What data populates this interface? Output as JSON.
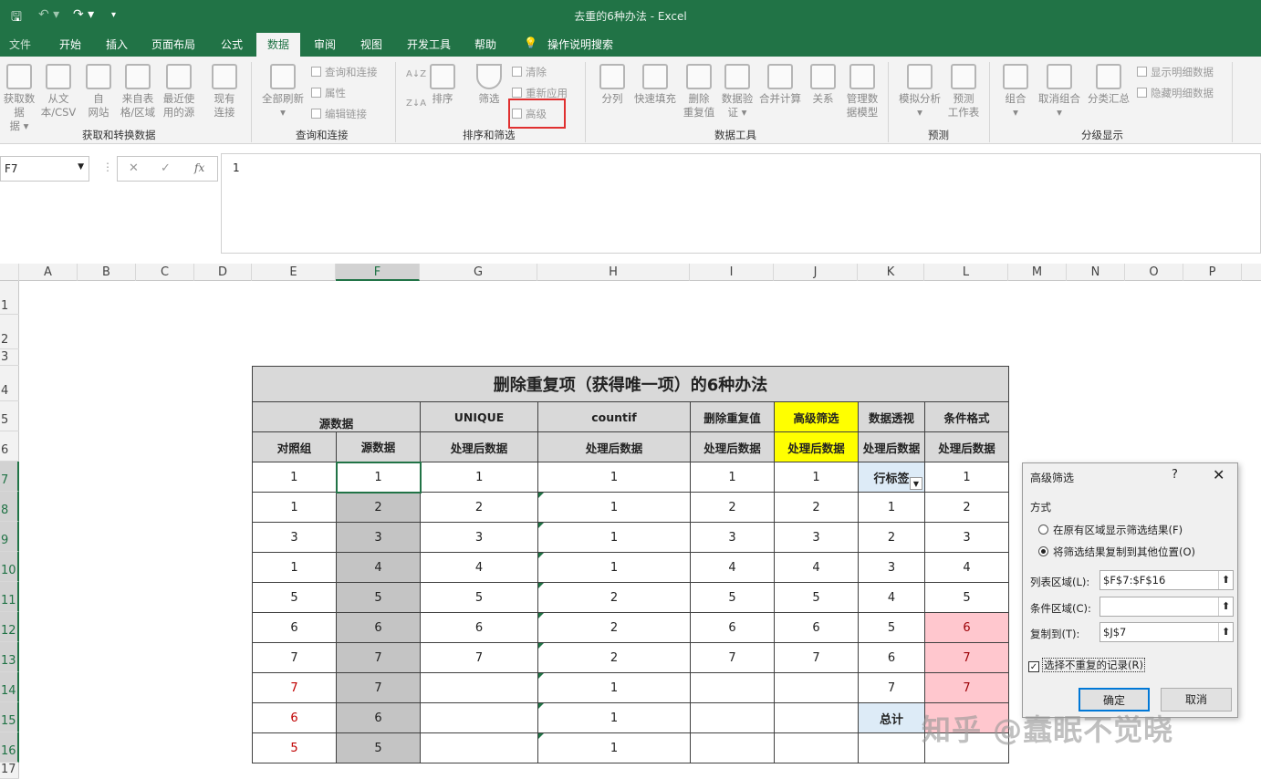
{
  "window": {
    "title": "去重的6种办法  -  Excel"
  },
  "tabs": [
    "文件",
    "开始",
    "插入",
    "页面布局",
    "公式",
    "数据",
    "审阅",
    "视图",
    "开发工具",
    "帮助"
  ],
  "tell_me": "操作说明搜索",
  "ribbon": {
    "get_data": {
      "b1": "获取数据",
      "b1b": "据 ▾",
      "b2": "从文",
      "b2b": "本/CSV",
      "b3": "自",
      "b3b": "网站",
      "b4": "来自表",
      "b4b": "格/区域",
      "b5": "最近使",
      "b5b": "用的源",
      "b6": "现有",
      "b6b": "连接",
      "label": "获取和转换数据"
    },
    "queries": {
      "refresh": "全部刷新",
      "refresh_b": "▾",
      "q1": "查询和连接",
      "q2": "属性",
      "q3": "编辑链接",
      "label": "查询和连接"
    },
    "sort": {
      "az": "A↓Z",
      "za": "Z↓A",
      "sort": "排序",
      "filter": "筛选",
      "clear": "清除",
      "reapply": "重新应用",
      "advanced": "高级",
      "label": "排序和筛选"
    },
    "tools": {
      "split": "分列",
      "flash": "快速填充",
      "dup": "删除",
      "dup_b": "重复值",
      "valid": "数据验",
      "valid_b": "证 ▾",
      "consol": "合并计算",
      "rel": "关系",
      "model": "管理数",
      "model_b": "据模型",
      "label": "数据工具"
    },
    "forecast": {
      "whatif": "模拟分析",
      "whatif_b": "▾",
      "sheet": "预测",
      "sheet_b": "工作表",
      "label": "预测"
    },
    "outline": {
      "group": "组合",
      "group_b": "▾",
      "ungroup": "取消组合",
      "ungroup_b": "▾",
      "subtotal": "分类汇总",
      "show": "显示明细数据",
      "hide": "隐藏明细数据",
      "label": "分级显示"
    }
  },
  "formula_bar": {
    "namebox": "F7",
    "cancel": "✕",
    "enter": "✓",
    "fx": "fx",
    "value": "1"
  },
  "columns": [
    "A",
    "B",
    "C",
    "D",
    "E",
    "F",
    "G",
    "H",
    "I",
    "J",
    "K",
    "L",
    "M",
    "N",
    "O",
    "P"
  ],
  "rows": [
    "1",
    "2",
    "3",
    "4",
    "5",
    "6",
    "7",
    "8",
    "9",
    "10",
    "11",
    "12",
    "13",
    "14",
    "15",
    "16",
    "17"
  ],
  "table": {
    "title": "删除重复项（获得唯一项）的6种办法",
    "h1": {
      "src": "源数据",
      "unique": "UNIQUE",
      "countif": "countif",
      "dedup": "删除重复值",
      "adv": "高级筛选",
      "pivot": "数据透视",
      "cond": "条件格式"
    },
    "h2": {
      "ctrl": "对照组",
      "src": "源数据",
      "processed": "处理后数据"
    },
    "rows": [
      {
        "e": "1",
        "f": "1",
        "g": "1",
        "h": "1",
        "i": "1",
        "j": "1",
        "k": "行标签",
        "l": "1"
      },
      {
        "e": "1",
        "f": "2",
        "g": "2",
        "h": "1",
        "i": "2",
        "j": "2",
        "k": "1",
        "l": "2"
      },
      {
        "e": "3",
        "f": "3",
        "g": "3",
        "h": "1",
        "i": "3",
        "j": "3",
        "k": "2",
        "l": "3"
      },
      {
        "e": "1",
        "f": "4",
        "g": "4",
        "h": "1",
        "i": "4",
        "j": "4",
        "k": "3",
        "l": "4"
      },
      {
        "e": "5",
        "f": "5",
        "g": "5",
        "h": "2",
        "i": "5",
        "j": "5",
        "k": "4",
        "l": "5"
      },
      {
        "e": "6",
        "f": "6",
        "g": "6",
        "h": "2",
        "i": "6",
        "j": "6",
        "k": "5",
        "l": "6"
      },
      {
        "e": "7",
        "f": "7",
        "g": "7",
        "h": "2",
        "i": "7",
        "j": "7",
        "k": "6",
        "l": "7"
      },
      {
        "e": "7",
        "f": "7",
        "g": "",
        "h": "1",
        "i": "",
        "j": "",
        "k": "7",
        "l": "7"
      },
      {
        "e": "6",
        "f": "6",
        "g": "",
        "h": "1",
        "i": "",
        "j": "",
        "k": "总计",
        "l": ""
      },
      {
        "e": "5",
        "f": "5",
        "g": "",
        "h": "1",
        "i": "",
        "j": "",
        "k": "",
        "l": ""
      }
    ]
  },
  "dialog": {
    "title": "高级筛选",
    "help": "?",
    "close": "✕",
    "method": "方式",
    "opt1": "在原有区域显示筛选结果(F)",
    "opt2": "将筛选结果复制到其他位置(O)",
    "list_label": "列表区域(L):",
    "list_value": "$F$7:$F$16",
    "crit_label": "条件区域(C):",
    "crit_value": "",
    "copy_label": "复制到(T):",
    "copy_value": "$J$7",
    "unique": "选择不重复的记录(R)",
    "ok": "确定",
    "cancel": "取消"
  },
  "watermark": "知乎 @蠢眠不觉晓",
  "colors": {
    "excel_green": "#217346",
    "highlight_yellow": "#ffff00",
    "pink": "#ffc7ce",
    "red_box": "#e03030"
  }
}
